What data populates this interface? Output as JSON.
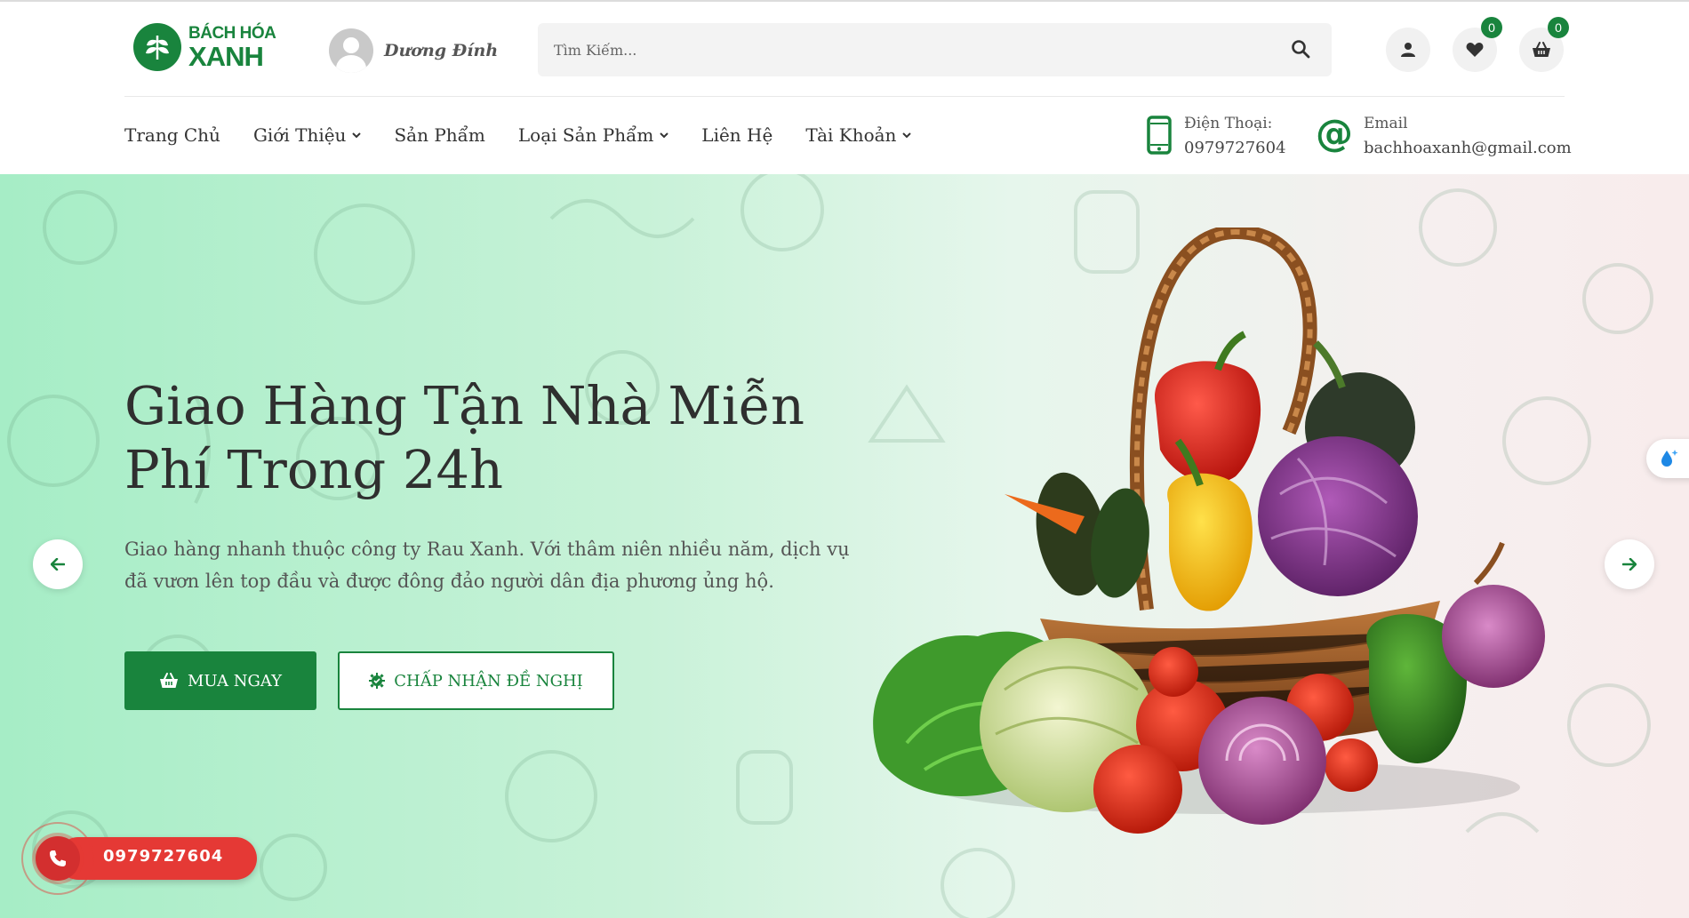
{
  "brand": {
    "name_line1": "BÁCH HÓA",
    "name_line2": "XANH",
    "color": "#19843d"
  },
  "user": {
    "name": "Dương Đính"
  },
  "search": {
    "placeholder": "Tìm Kiếm...",
    "value": ""
  },
  "header_icons": {
    "account": "user-icon",
    "wishlist": {
      "icon": "heart-icon",
      "count": "0"
    },
    "cart": {
      "icon": "basket-icon",
      "count": "0"
    }
  },
  "nav": {
    "home": "Trang Chủ",
    "about": "Giới Thiệu",
    "products": "Sản Phẩm",
    "categories": "Loại Sản Phẩm",
    "contact": "Liên Hệ",
    "account": "Tài Khoản"
  },
  "contact_info": {
    "phone_label": "Điện Thoại:",
    "phone_value": "0979727604",
    "email_label": "Email",
    "email_value": "bachhoaxanh@gmail.com"
  },
  "hero": {
    "title_line1": "Giao Hàng Tận Nhà Miễn",
    "title_line2": "Phí Trong 24h",
    "desc_line1": "Giao hàng nhanh thuộc công ty Rau Xanh. Với thâm niên nhiều năm, dịch vụ",
    "desc_line2": "đã vươn lên top đầu và được đông đảo người dân địa phương ủng hộ.",
    "buy_label": "MUA NGAY",
    "offer_label": "CHẤP NHẬN ĐỀ NGHỊ",
    "background_start": "#a6edc6",
    "background_end": "#f8ecec"
  },
  "floating_phone": {
    "number": "0979727604",
    "color": "#e53935"
  }
}
